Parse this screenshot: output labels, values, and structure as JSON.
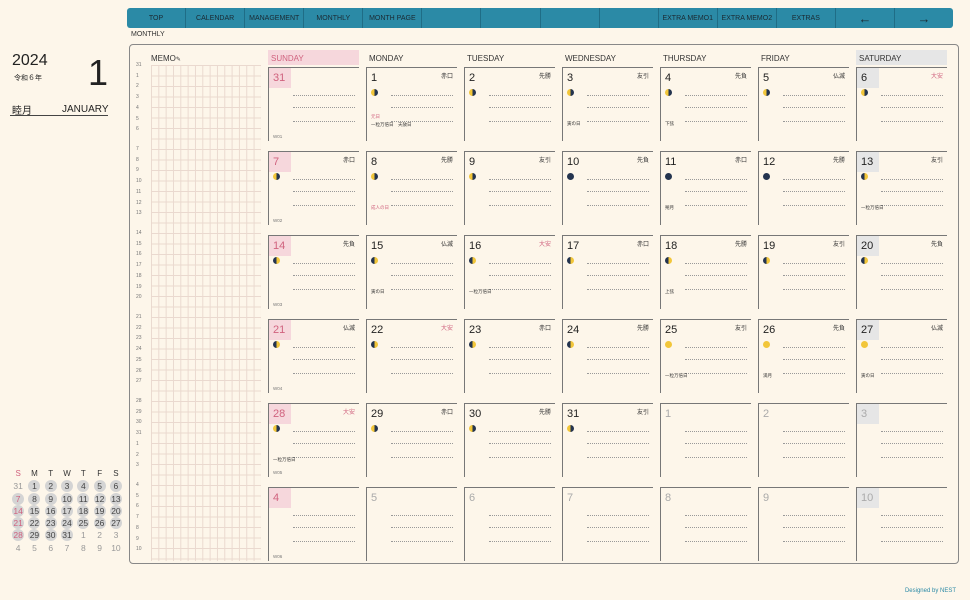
{
  "nav": [
    "TOP",
    "CALENDAR",
    "MANAGEMENT",
    "MONTHLY",
    "MONTH PAGE",
    "",
    "",
    "",
    "",
    "EXTRA MEMO1",
    "EXTRA MEMO2",
    "EXTRAS",
    "←",
    "→"
  ],
  "section_label": "MONTHLY",
  "year": "2024",
  "reiwa": "令和６年",
  "month_number": "1",
  "month_kanji": "睦月",
  "month_english": "JANUARY",
  "memo_label": "MEMO",
  "memo_icon": "pencil-icon",
  "weekdays": [
    "SUNDAY",
    "MONDAY",
    "TUESDAY",
    "WEDNESDAY",
    "THURSDAY",
    "FRIDAY",
    "SATURDAY"
  ],
  "left_week_numbers": [
    [
      "31",
      "1",
      "2",
      "3",
      "4",
      "5",
      "6"
    ],
    [
      "7",
      "8",
      "9",
      "10",
      "11",
      "12",
      "13"
    ],
    [
      "14",
      "15",
      "16",
      "17",
      "18",
      "19",
      "20"
    ],
    [
      "21",
      "22",
      "23",
      "24",
      "25",
      "26",
      "27"
    ],
    [
      "28",
      "29",
      "30",
      "31",
      "1",
      "2",
      "3"
    ],
    [
      "4",
      "5",
      "6",
      "7",
      "8",
      "9",
      "10"
    ]
  ],
  "weeks": [
    {
      "label": "W01",
      "days": [
        {
          "day": "31",
          "rokuyo": "",
          "moon": "",
          "notes": [],
          "other": true
        },
        {
          "day": "1",
          "rokuyo": "赤口",
          "moon": "m-wan",
          "notes": [
            {
              "t": "元日",
              "red": true
            },
            {
              "t": "一粒万倍日　天赦日",
              "red": false
            }
          ]
        },
        {
          "day": "2",
          "rokuyo": "先勝",
          "moon": "m-wan",
          "notes": []
        },
        {
          "day": "3",
          "rokuyo": "友引",
          "moon": "m-wan",
          "notes": [
            {
              "t": "寅の日",
              "red": false
            }
          ]
        },
        {
          "day": "4",
          "rokuyo": "先負",
          "moon": "m-wan",
          "notes": [
            {
              "t": "下弦",
              "red": false
            }
          ]
        },
        {
          "day": "5",
          "rokuyo": "仏滅",
          "moon": "m-wan",
          "notes": []
        },
        {
          "day": "6",
          "rokuyo": "大安",
          "rokuyo_red": true,
          "moon": "m-wan",
          "notes": []
        }
      ]
    },
    {
      "label": "W02",
      "days": [
        {
          "day": "7",
          "rokuyo": "赤口",
          "moon": "m-wan",
          "notes": []
        },
        {
          "day": "8",
          "rokuyo": "先勝",
          "moon": "m-wan",
          "notes": [
            {
              "t": "成人の日",
              "red": true
            }
          ]
        },
        {
          "day": "9",
          "rokuyo": "友引",
          "moon": "m-wan",
          "notes": []
        },
        {
          "day": "10",
          "rokuyo": "先負",
          "moon": "m-new",
          "notes": []
        },
        {
          "day": "11",
          "rokuyo": "赤口",
          "moon": "m-new",
          "notes": [
            {
              "t": "朔月",
              "red": false
            }
          ]
        },
        {
          "day": "12",
          "rokuyo": "先勝",
          "moon": "m-new",
          "notes": []
        },
        {
          "day": "13",
          "rokuyo": "友引",
          "moon": "m-wax",
          "notes": [
            {
              "t": "一粒万倍日",
              "red": false
            }
          ]
        }
      ]
    },
    {
      "label": "W03",
      "days": [
        {
          "day": "14",
          "rokuyo": "先負",
          "moon": "m-wax",
          "notes": []
        },
        {
          "day": "15",
          "rokuyo": "仏滅",
          "moon": "m-wax",
          "notes": [
            {
              "t": "寅の日",
              "red": false
            }
          ]
        },
        {
          "day": "16",
          "rokuyo": "大安",
          "rokuyo_red": true,
          "moon": "m-wax",
          "notes": [
            {
              "t": "一粒万倍日",
              "red": false
            }
          ]
        },
        {
          "day": "17",
          "rokuyo": "赤口",
          "moon": "m-wax",
          "notes": []
        },
        {
          "day": "18",
          "rokuyo": "先勝",
          "moon": "m-wax",
          "notes": [
            {
              "t": "上弦",
              "red": false
            }
          ]
        },
        {
          "day": "19",
          "rokuyo": "友引",
          "moon": "m-wax",
          "notes": []
        },
        {
          "day": "20",
          "rokuyo": "先負",
          "moon": "m-wax",
          "notes": []
        }
      ]
    },
    {
      "label": "W04",
      "days": [
        {
          "day": "21",
          "rokuyo": "仏滅",
          "moon": "m-wax",
          "notes": []
        },
        {
          "day": "22",
          "rokuyo": "大安",
          "rokuyo_red": true,
          "moon": "m-wax",
          "notes": []
        },
        {
          "day": "23",
          "rokuyo": "赤口",
          "moon": "m-wax",
          "notes": []
        },
        {
          "day": "24",
          "rokuyo": "先勝",
          "moon": "m-wax",
          "notes": []
        },
        {
          "day": "25",
          "rokuyo": "友引",
          "moon": "m-full",
          "notes": [
            {
              "t": "一粒万倍日",
              "red": false
            }
          ]
        },
        {
          "day": "26",
          "rokuyo": "先負",
          "moon": "m-full",
          "notes": [
            {
              "t": "満月",
              "red": false
            }
          ]
        },
        {
          "day": "27",
          "rokuyo": "仏滅",
          "moon": "m-full",
          "notes": [
            {
              "t": "寅の日",
              "red": false
            }
          ]
        }
      ]
    },
    {
      "label": "W05",
      "days": [
        {
          "day": "28",
          "rokuyo": "大安",
          "rokuyo_red": true,
          "moon": "m-wan",
          "notes": [
            {
              "t": "一粒万倍日",
              "red": false
            }
          ]
        },
        {
          "day": "29",
          "rokuyo": "赤口",
          "moon": "m-wan",
          "notes": []
        },
        {
          "day": "30",
          "rokuyo": "先勝",
          "moon": "m-wan",
          "notes": []
        },
        {
          "day": "31",
          "rokuyo": "友引",
          "moon": "m-wan",
          "notes": []
        },
        {
          "day": "1",
          "rokuyo": "",
          "moon": "",
          "notes": [],
          "other": true
        },
        {
          "day": "2",
          "rokuyo": "",
          "moon": "",
          "notes": [],
          "other": true
        },
        {
          "day": "3",
          "rokuyo": "",
          "moon": "",
          "notes": [],
          "other": true
        }
      ]
    },
    {
      "label": "W06",
      "days": [
        {
          "day": "4",
          "rokuyo": "",
          "moon": "",
          "notes": [],
          "other": true
        },
        {
          "day": "5",
          "rokuyo": "",
          "moon": "",
          "notes": [],
          "other": true
        },
        {
          "day": "6",
          "rokuyo": "",
          "moon": "",
          "notes": [],
          "other": true
        },
        {
          "day": "7",
          "rokuyo": "",
          "moon": "",
          "notes": [],
          "other": true
        },
        {
          "day": "8",
          "rokuyo": "",
          "moon": "",
          "notes": [],
          "other": true
        },
        {
          "day": "9",
          "rokuyo": "",
          "moon": "",
          "notes": [],
          "other": true
        },
        {
          "day": "10",
          "rokuyo": "",
          "moon": "",
          "notes": [],
          "other": true
        }
      ]
    }
  ],
  "mini_calendar": {
    "headers": [
      "S",
      "M",
      "T",
      "W",
      "T",
      "F",
      "S"
    ],
    "rows": [
      [
        {
          "d": "31",
          "cur": false
        },
        {
          "d": "1",
          "cur": true
        },
        {
          "d": "2",
          "cur": true
        },
        {
          "d": "3",
          "cur": true
        },
        {
          "d": "4",
          "cur": true
        },
        {
          "d": "5",
          "cur": true
        },
        {
          "d": "6",
          "cur": true
        }
      ],
      [
        {
          "d": "7",
          "cur": true
        },
        {
          "d": "8",
          "cur": true
        },
        {
          "d": "9",
          "cur": true
        },
        {
          "d": "10",
          "cur": true
        },
        {
          "d": "11",
          "cur": true
        },
        {
          "d": "12",
          "cur": true
        },
        {
          "d": "13",
          "cur": true
        }
      ],
      [
        {
          "d": "14",
          "cur": true
        },
        {
          "d": "15",
          "cur": true
        },
        {
          "d": "16",
          "cur": true
        },
        {
          "d": "17",
          "cur": true
        },
        {
          "d": "18",
          "cur": true
        },
        {
          "d": "19",
          "cur": true
        },
        {
          "d": "20",
          "cur": true
        }
      ],
      [
        {
          "d": "21",
          "cur": true
        },
        {
          "d": "22",
          "cur": true
        },
        {
          "d": "23",
          "cur": true
        },
        {
          "d": "24",
          "cur": true
        },
        {
          "d": "25",
          "cur": true
        },
        {
          "d": "26",
          "cur": true
        },
        {
          "d": "27",
          "cur": true
        }
      ],
      [
        {
          "d": "28",
          "cur": true
        },
        {
          "d": "29",
          "cur": true
        },
        {
          "d": "30",
          "cur": true
        },
        {
          "d": "31",
          "cur": true
        },
        {
          "d": "1",
          "cur": false
        },
        {
          "d": "2",
          "cur": false
        },
        {
          "d": "3",
          "cur": false
        }
      ],
      [
        {
          "d": "4",
          "cur": false
        },
        {
          "d": "5",
          "cur": false
        },
        {
          "d": "6",
          "cur": false
        },
        {
          "d": "7",
          "cur": false
        },
        {
          "d": "8",
          "cur": false
        },
        {
          "d": "9",
          "cur": false
        },
        {
          "d": "10",
          "cur": false
        }
      ]
    ]
  },
  "credit": "Designed by NEST",
  "colors": {
    "accent": "#2b8aa6",
    "sunday": "#d0627e",
    "background": "#fdf6ea"
  }
}
